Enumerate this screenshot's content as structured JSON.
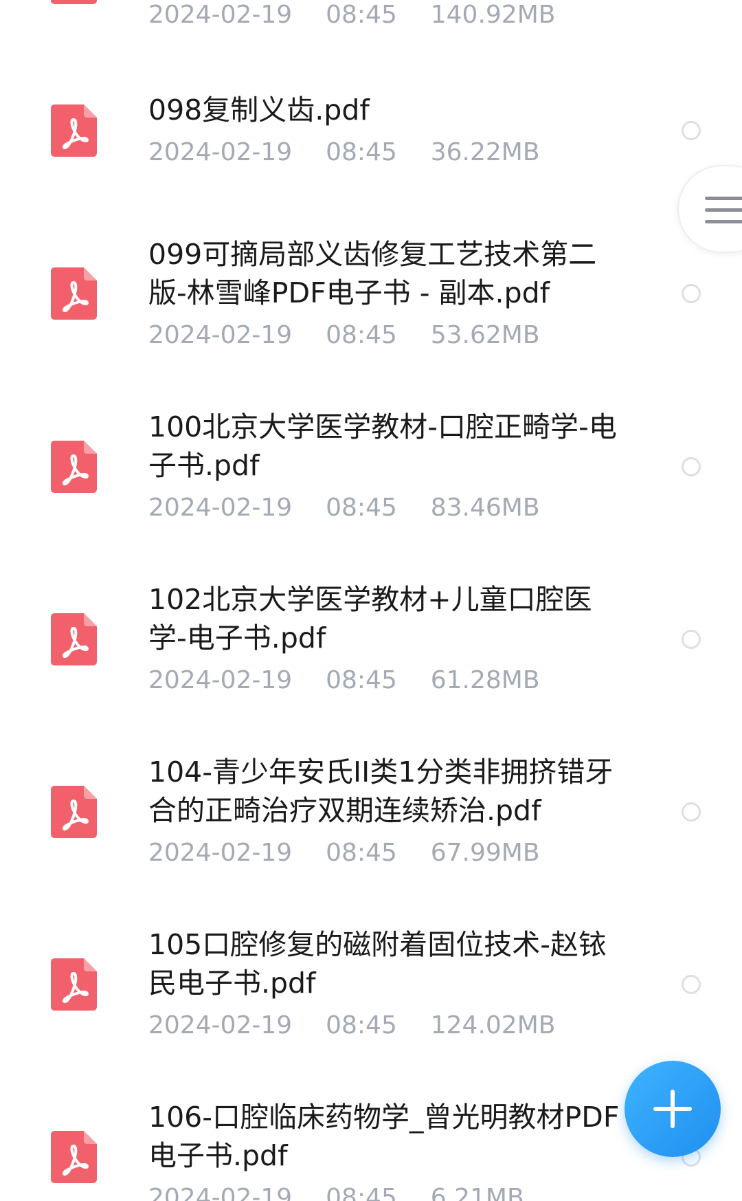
{
  "files": [
    {
      "name": "",
      "date": "2024-02-19",
      "time": "08:45",
      "size": "140.92MB"
    },
    {
      "name": "098复制义齿.pdf",
      "date": "2024-02-19",
      "time": "08:45",
      "size": "36.22MB"
    },
    {
      "name": "099可摘局部义齿修复工艺技术第二版-林雪峰PDF电子书 - 副本.pdf",
      "date": "2024-02-19",
      "time": "08:45",
      "size": "53.62MB"
    },
    {
      "name": "100北京大学医学教材-口腔正畸学-电子书.pdf",
      "date": "2024-02-19",
      "time": "08:45",
      "size": "83.46MB"
    },
    {
      "name": "102北京大学医学教材+儿童口腔医学-电子书.pdf",
      "date": "2024-02-19",
      "time": "08:45",
      "size": "61.28MB"
    },
    {
      "name": "104-青少年安氏II类1分类非拥挤错牙合的正畸治疗双期连续矫治.pdf",
      "date": "2024-02-19",
      "time": "08:45",
      "size": "67.99MB"
    },
    {
      "name": "105口腔修复的磁附着固位技术-赵铱民电子书.pdf",
      "date": "2024-02-19",
      "time": "08:45",
      "size": "124.02MB"
    },
    {
      "name": "106-口腔临床药物学_曾光明教材PDF电子书.pdf",
      "date": "2024-02-19",
      "time": "08:45",
      "size": "6.21MB"
    }
  ],
  "icons": {
    "file_icon": "pdf-file-icon",
    "menu_icon": "hamburger-menu-icon",
    "fab_icon": "plus-icon"
  },
  "colors": {
    "pdf_icon": "#f2616b",
    "fab": "#2a9df4",
    "meta_text": "#a3aab4"
  }
}
